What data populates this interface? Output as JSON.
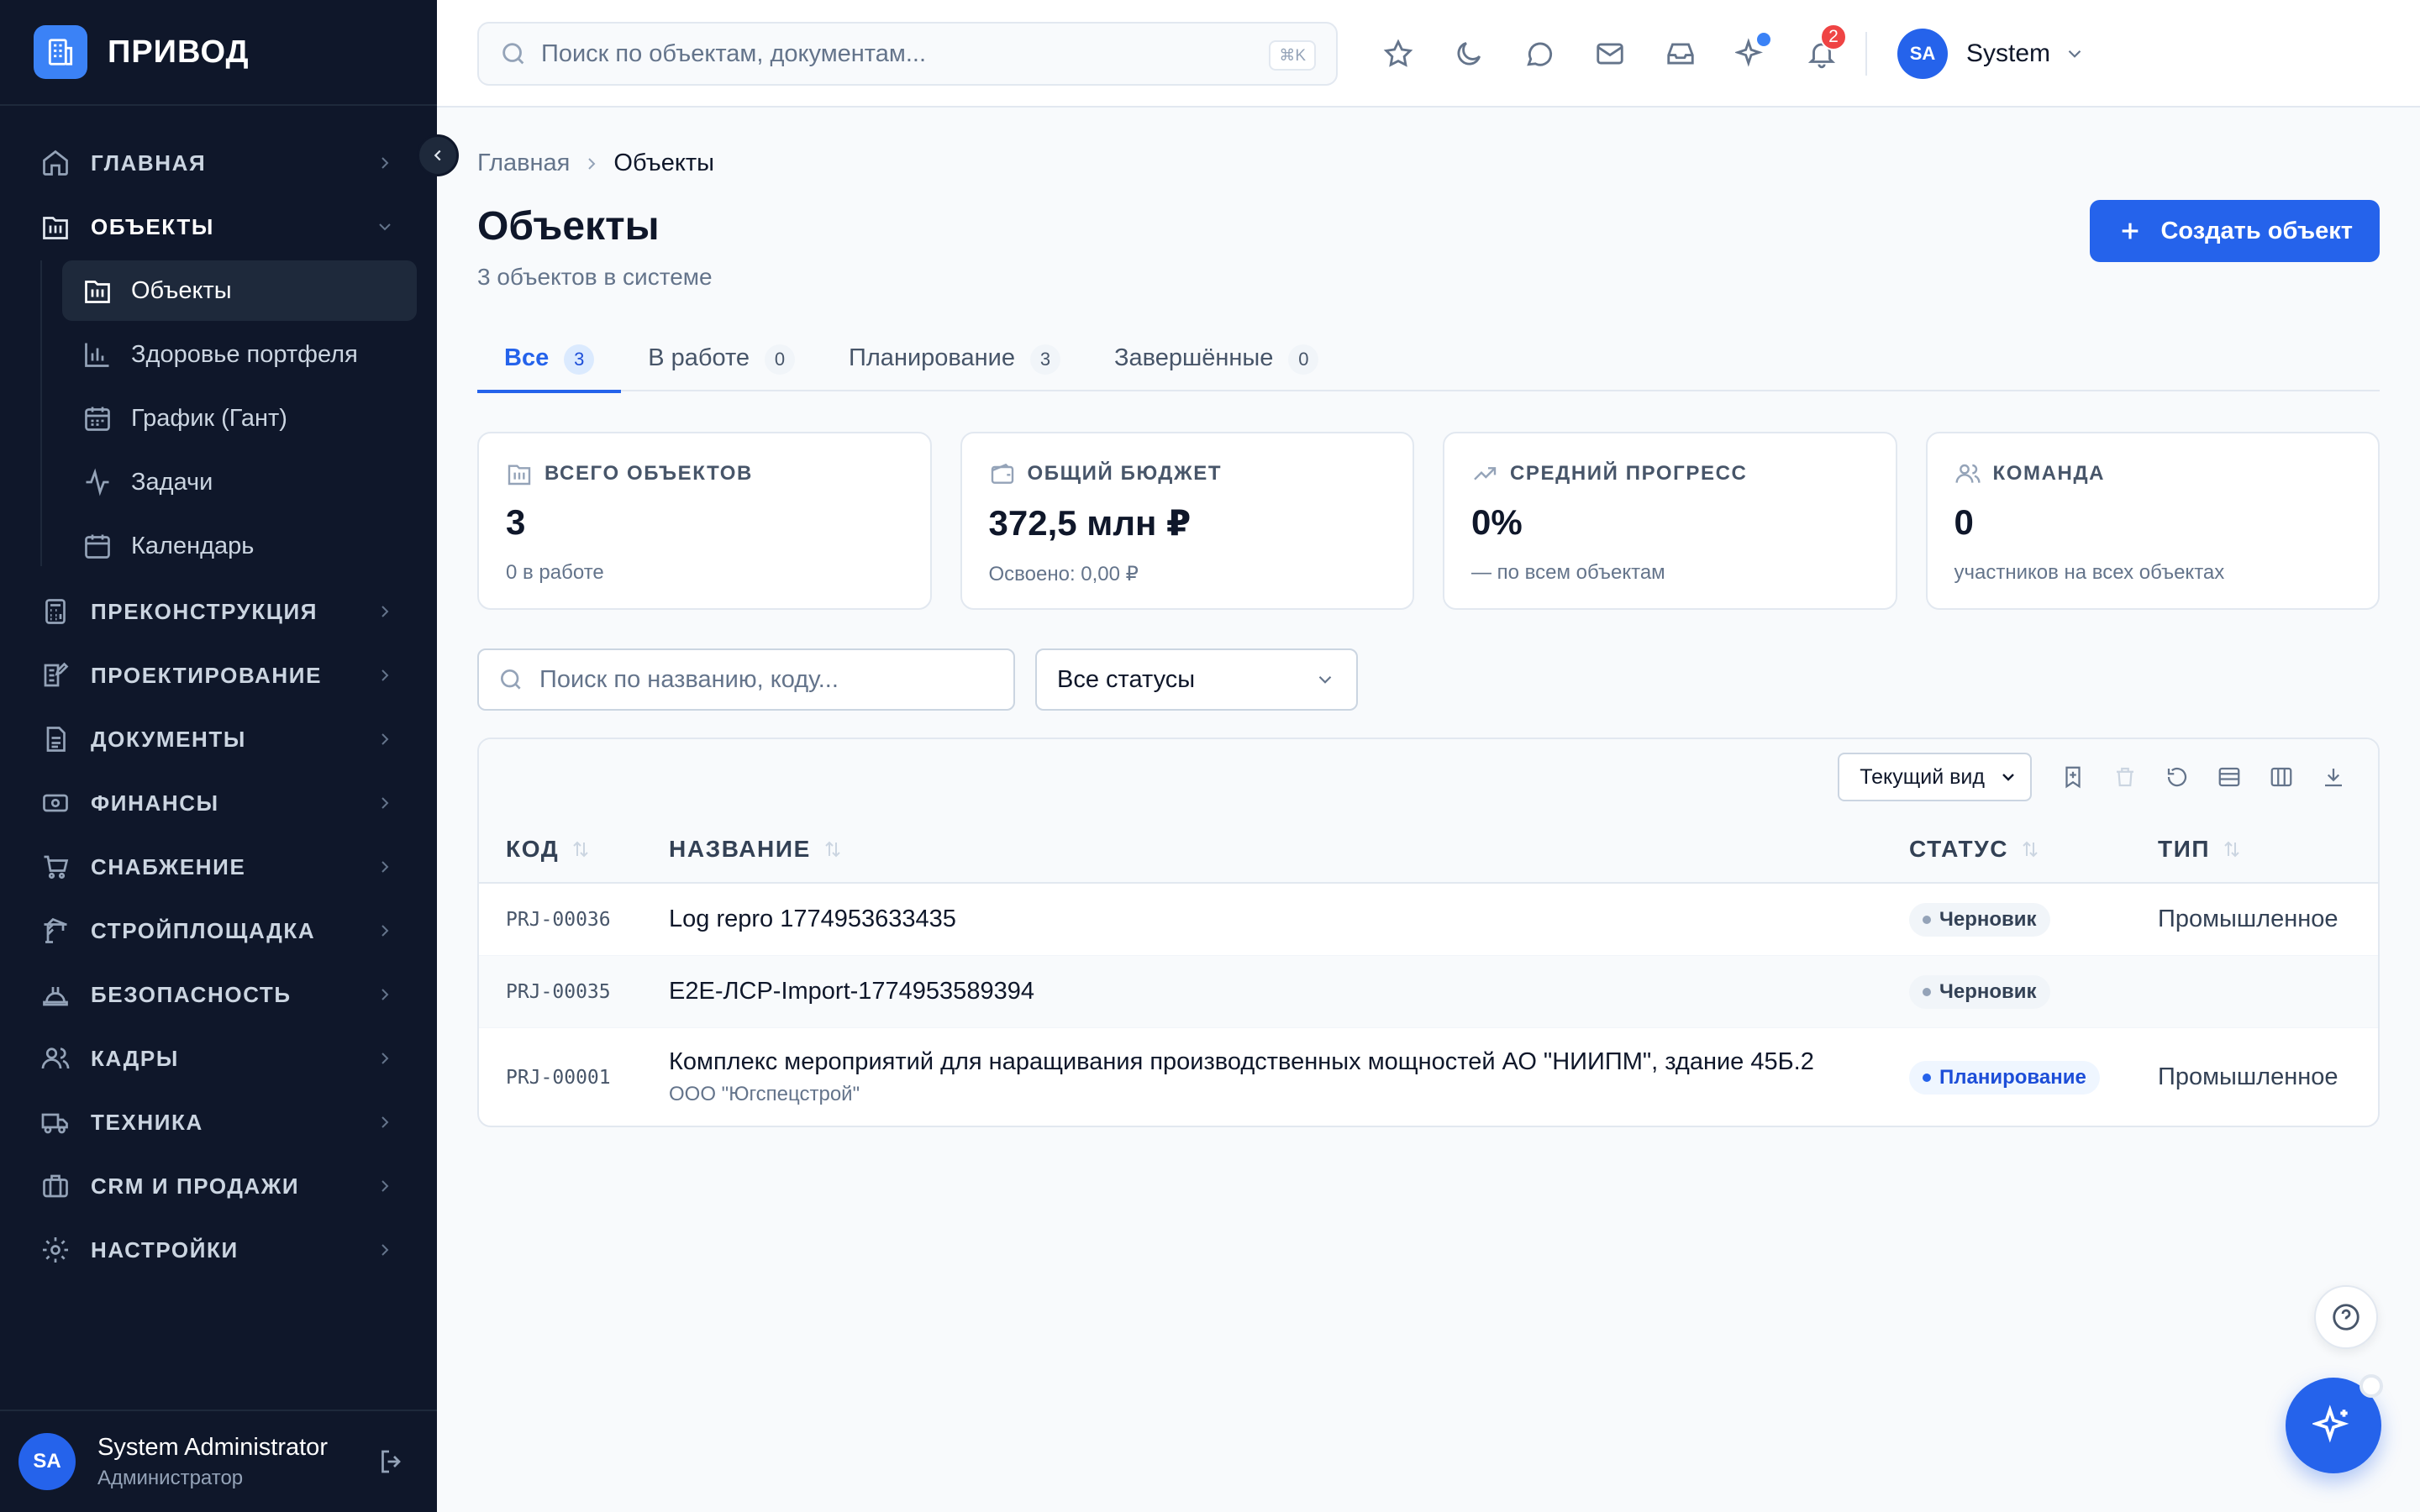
{
  "brand": {
    "name": "ПРИВОД"
  },
  "sidebar": {
    "items": [
      {
        "label": "ГЛАВНАЯ",
        "icon": "home-icon"
      },
      {
        "label": "ОБЪЕКТЫ",
        "icon": "building-icon",
        "open": true
      },
      {
        "label": "ПРЕКОНСТРУКЦИЯ",
        "icon": "calculator-icon"
      },
      {
        "label": "ПРОЕКТИРОВАНИЕ",
        "icon": "blueprint-icon"
      },
      {
        "label": "ДОКУМЕНТЫ",
        "icon": "document-icon"
      },
      {
        "label": "ФИНАНСЫ",
        "icon": "money-icon"
      },
      {
        "label": "СНАБЖЕНИЕ",
        "icon": "cart-icon"
      },
      {
        "label": "СТРОЙПЛОЩАДКА",
        "icon": "crane-icon"
      },
      {
        "label": "БЕЗОПАСНОСТЬ",
        "icon": "hardhat-icon"
      },
      {
        "label": "КАДРЫ",
        "icon": "users-icon"
      },
      {
        "label": "ТЕХНИКА",
        "icon": "truck-icon"
      },
      {
        "label": "CRM И ПРОДАЖИ",
        "icon": "briefcase-icon"
      },
      {
        "label": "НАСТРОЙКИ",
        "icon": "gear-icon"
      }
    ],
    "subitems": [
      {
        "label": "Объекты",
        "active": true
      },
      {
        "label": "Здоровье портфеля"
      },
      {
        "label": "График (Гант)"
      },
      {
        "label": "Задачи"
      },
      {
        "label": "Календарь"
      }
    ],
    "user": {
      "initials": "SA",
      "name": "System Administrator",
      "role": "Администратор"
    }
  },
  "topbar": {
    "search_placeholder": "Поиск по объектам, документам...",
    "shortcut": "⌘K",
    "notifications_count": "2",
    "user_initials": "SA",
    "user_name": "System"
  },
  "breadcrumb": {
    "home": "Главная",
    "current": "Объекты"
  },
  "page": {
    "title": "Объекты",
    "subtitle": "3 объектов в системе",
    "create_label": "Создать объект"
  },
  "tabs": [
    {
      "label": "Все",
      "count": "3",
      "active": true
    },
    {
      "label": "В работе",
      "count": "0"
    },
    {
      "label": "Планирование",
      "count": "3"
    },
    {
      "label": "Завершённые",
      "count": "0"
    }
  ],
  "stats": [
    {
      "label": "ВСЕГО ОБЪЕКТОВ",
      "value": "3",
      "sub": "0 в работе",
      "icon": "building-icon"
    },
    {
      "label": "ОБЩИЙ БЮДЖЕТ",
      "value": "372,5 млн ₽",
      "sub": "Освоено: 0,00 ₽",
      "icon": "wallet-icon"
    },
    {
      "label": "СРЕДНИЙ ПРОГРЕСС",
      "value": "0%",
      "sub": "— по всем объектам",
      "icon": "trend-icon"
    },
    {
      "label": "КОМАНДА",
      "value": "0",
      "sub": "участников на всех объектах",
      "icon": "users-icon"
    }
  ],
  "filters": {
    "search_placeholder": "Поиск по названию, коду...",
    "status_value": "Все статусы"
  },
  "table": {
    "view_label": "Текущий вид",
    "columns": {
      "code": "КОД",
      "name": "НАЗВАНИЕ",
      "status": "СТАТУС",
      "type": "ТИП"
    },
    "rows": [
      {
        "code": "PRJ-00036",
        "name": "Log repro 1774953633435",
        "client": "",
        "status": "Черновик",
        "status_kind": "draft",
        "type": "Промышленное"
      },
      {
        "code": "PRJ-00035",
        "name": "E2E-ЛСР-Import-1774953589394",
        "client": "",
        "status": "Черновик",
        "status_kind": "draft",
        "type": ""
      },
      {
        "code": "PRJ-00001",
        "name": "Комплекс мероприятий для наращивания производственных мощностей АО \"НИИПМ\", здание 45Б.2",
        "client": "ООО \"Югспецстрой\"",
        "status": "Планирование",
        "status_kind": "plan",
        "type": "Промышленное"
      }
    ]
  },
  "colors": {
    "accent": "#2563eb",
    "sidebar_bg": "#0f172a",
    "danger": "#ef4444"
  }
}
